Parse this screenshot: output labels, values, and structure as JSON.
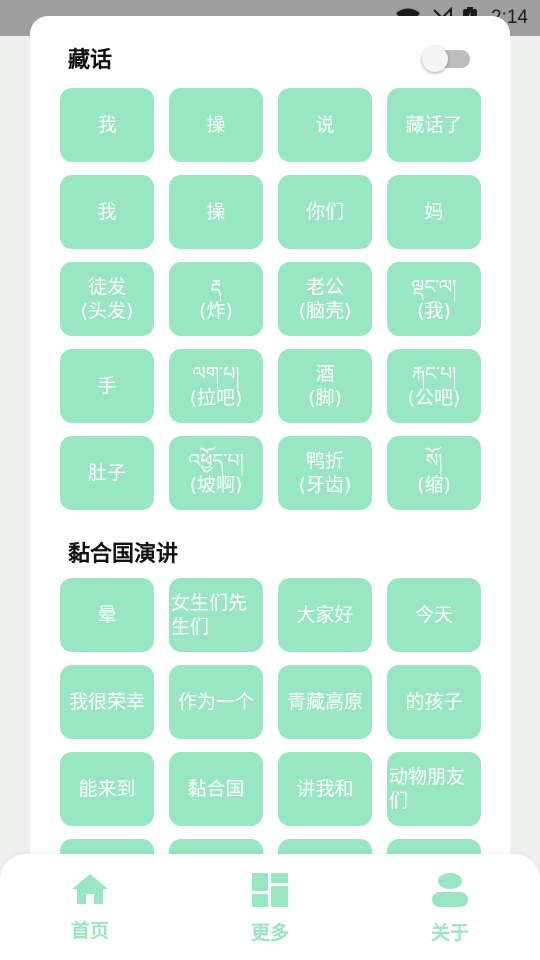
{
  "status_bar": {
    "time": "2:14"
  },
  "colors": {
    "accent": "#98e6c2",
    "button_text": "#ffffff"
  },
  "section1": {
    "title": "藏话",
    "toggle_on": false,
    "buttons": [
      {
        "label": "我"
      },
      {
        "label": "操"
      },
      {
        "label": "说"
      },
      {
        "label": "藏话了"
      },
      {
        "label": "我"
      },
      {
        "label": "操"
      },
      {
        "label": "你们"
      },
      {
        "label": "妈"
      },
      {
        "label": "徒发\n(头发)"
      },
      {
        "label": "རྡ\n(炸)"
      },
      {
        "label": "老公\n(脑壳)"
      },
      {
        "label": "ལྡང་ལ།\n(我)"
      },
      {
        "label": "手"
      },
      {
        "label": "ལག་པ།\n(拉吧)"
      },
      {
        "label": "酒\n(脚)"
      },
      {
        "label": "རྐང་པ།\n(公吧)"
      },
      {
        "label": "肚子"
      },
      {
        "label": "འཕྱོད་པ།\n(坡啊)"
      },
      {
        "label": "鸭折\n(牙齿)"
      },
      {
        "label": "སོ།\n(缩)"
      }
    ]
  },
  "section2": {
    "title": "黏合国演讲",
    "buttons": [
      {
        "label": "晕"
      },
      {
        "label": "女生们先\n生们"
      },
      {
        "label": "大家好"
      },
      {
        "label": "今天"
      },
      {
        "label": "我很荣幸"
      },
      {
        "label": "作为一个"
      },
      {
        "label": "青藏高原"
      },
      {
        "label": "的孩子"
      },
      {
        "label": "能来到"
      },
      {
        "label": "黏合国"
      },
      {
        "label": "讲我和"
      },
      {
        "label": "动物朋友\n们"
      },
      {
        "label": ""
      },
      {
        "label": ""
      },
      {
        "label": ""
      },
      {
        "label": ""
      }
    ]
  },
  "bottom_nav": [
    {
      "label": "首页",
      "icon": "home-icon"
    },
    {
      "label": "更多",
      "icon": "grid-icon"
    },
    {
      "label": "关于",
      "icon": "person-icon"
    }
  ]
}
